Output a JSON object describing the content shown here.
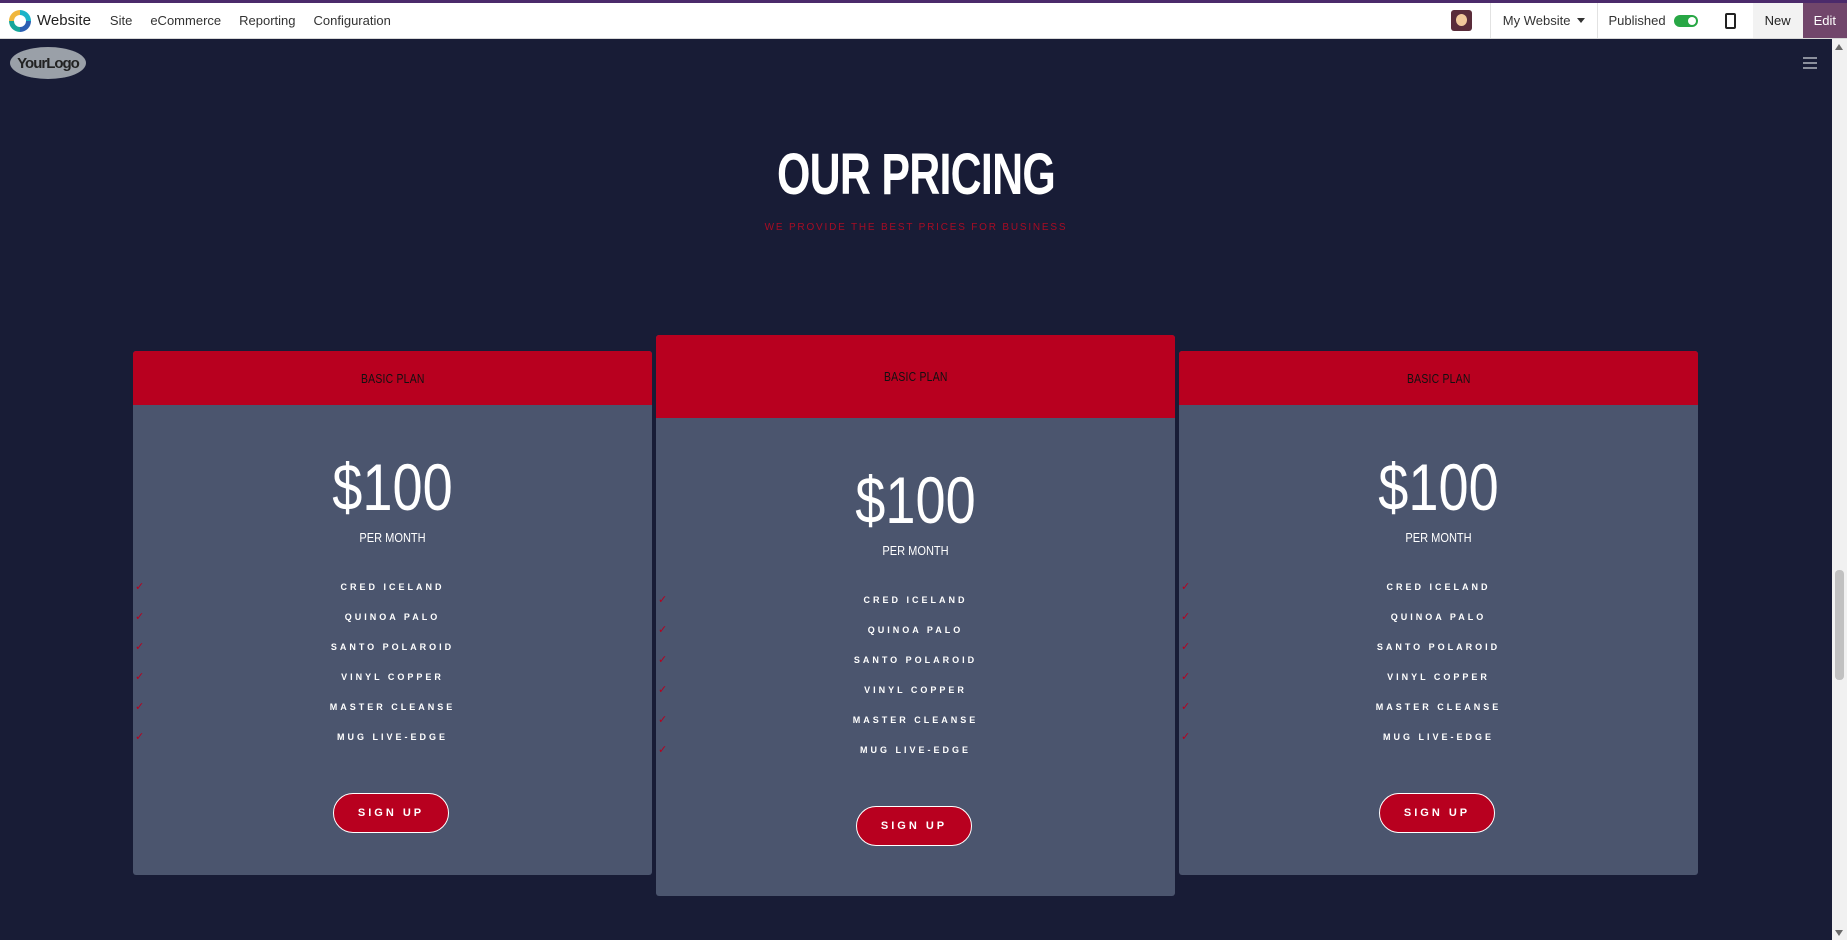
{
  "topbar": {
    "app_name": "Website",
    "menus": [
      "Site",
      "eCommerce",
      "Reporting",
      "Configuration"
    ],
    "website_selector": "My Website",
    "published_label": "Published",
    "new_label": "New",
    "edit_label": "Edit"
  },
  "site": {
    "logo_text": "YourLogo"
  },
  "section": {
    "title": "OUR PRICING",
    "subtitle": "WE PROVIDE THE BEST PRICES FOR BUSINESS"
  },
  "cards": [
    {
      "plan": "BASIC PLAN",
      "price": "$100",
      "period": "PER MONTH",
      "features": [
        "CRED ICELAND",
        "QUINOA PALO",
        "SANTO POLAROID",
        "VINYL COPPER",
        "MASTER CLEANSE",
        "MUG LIVE-EDGE"
      ],
      "button": "SIGN UP"
    },
    {
      "plan": "BASIC PLAN",
      "price": "$100",
      "period": "PER MONTH",
      "features": [
        "CRED ICELAND",
        "QUINOA PALO",
        "SANTO POLAROID",
        "VINYL COPPER",
        "MASTER CLEANSE",
        "MUG LIVE-EDGE"
      ],
      "button": "SIGN UP"
    },
    {
      "plan": "BASIC PLAN",
      "price": "$100",
      "period": "PER MONTH",
      "features": [
        "CRED ICELAND",
        "QUINOA PALO",
        "SANTO POLAROID",
        "VINYL COPPER",
        "MASTER CLEANSE",
        "MUG LIVE-EDGE"
      ],
      "button": "SIGN UP"
    }
  ],
  "colors": {
    "background": "#181c36",
    "card": "#4b556e",
    "accent": "#b8001f",
    "edit_button": "#71466b"
  }
}
